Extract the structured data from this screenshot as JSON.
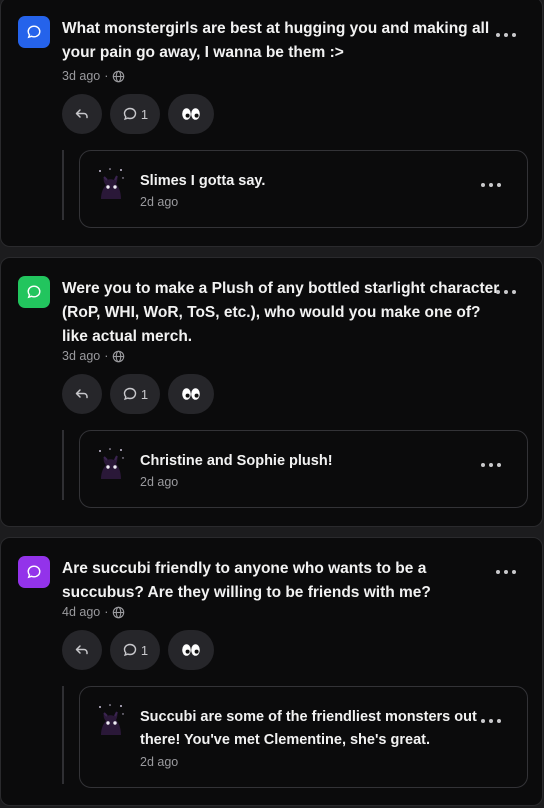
{
  "posts": [
    {
      "icon": "chat-bubble-icon",
      "icon_color": "#2563eb",
      "question": "What monstergirls are best at hugging you and making all your pain go away, I wanna be them :>",
      "age": "3d ago",
      "reply_count": "1",
      "answer": {
        "text": "Slimes I gotta say.",
        "age": "2d ago"
      }
    },
    {
      "icon": "chat-bubble-icon",
      "icon_color": "#22c55e",
      "question": "Were you to make a Plush of any bottled starlight character (RoP, WHI, WoR, ToS, etc.), who would you make one of? like actual merch.",
      "age": "3d ago",
      "reply_count": "1",
      "answer": {
        "text": "Christine and Sophie plush!",
        "age": "2d ago"
      }
    },
    {
      "icon": "chat-bubble-icon",
      "icon_color": "#9333ea",
      "question": "Are succubi friendly to anyone who wants to be a succubus? Are they willing to be friends with me?",
      "age": "4d ago",
      "reply_count": "1",
      "answer": {
        "text": "Succubi are some of the friendliest monsters out there! You've met Clementine, she's great.",
        "age": "2d ago"
      }
    }
  ],
  "meta_separator": "·"
}
